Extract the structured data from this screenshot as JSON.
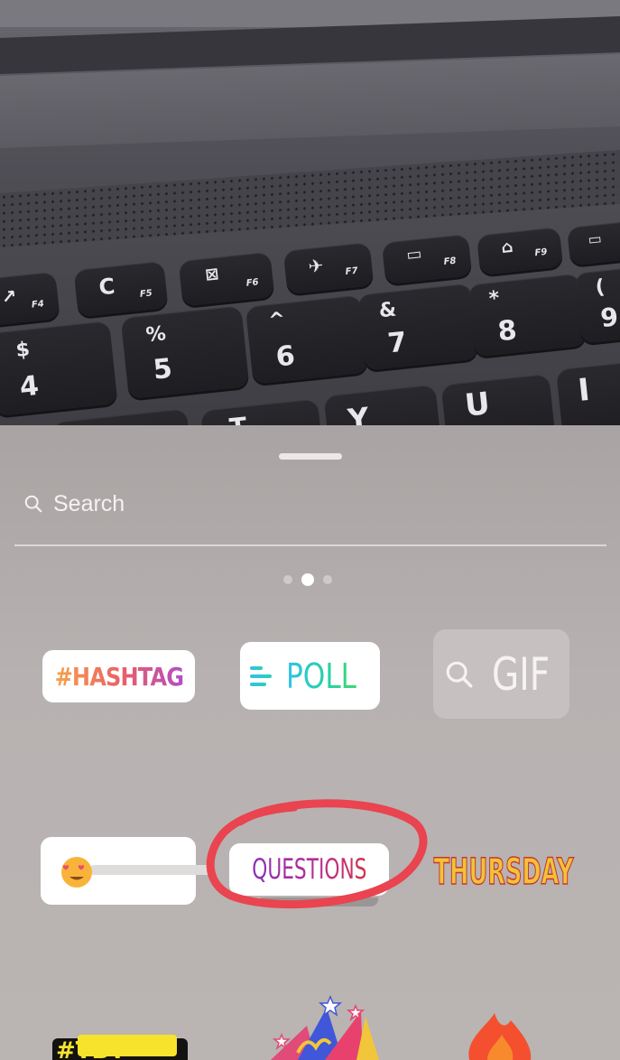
{
  "tray": {
    "search": {
      "label": "Search"
    },
    "page_dots": {
      "count": 3,
      "active_index": 1
    }
  },
  "stickers": {
    "hashtag": "#HASHTAG",
    "poll": "POLL",
    "gif": "GIF",
    "slider_emoji": "heart-eyes-face-icon",
    "questions": "QUESTIONS",
    "thursday": "THURSDAY",
    "tbt": "#TBT"
  },
  "annotation": {
    "circle_color": "#e9444f",
    "target": "questions-sticker"
  },
  "colors": {
    "tray_background": "#b7b2b1",
    "sticker_background": "#ffffff",
    "gif_background": "#c6c1c0"
  }
}
